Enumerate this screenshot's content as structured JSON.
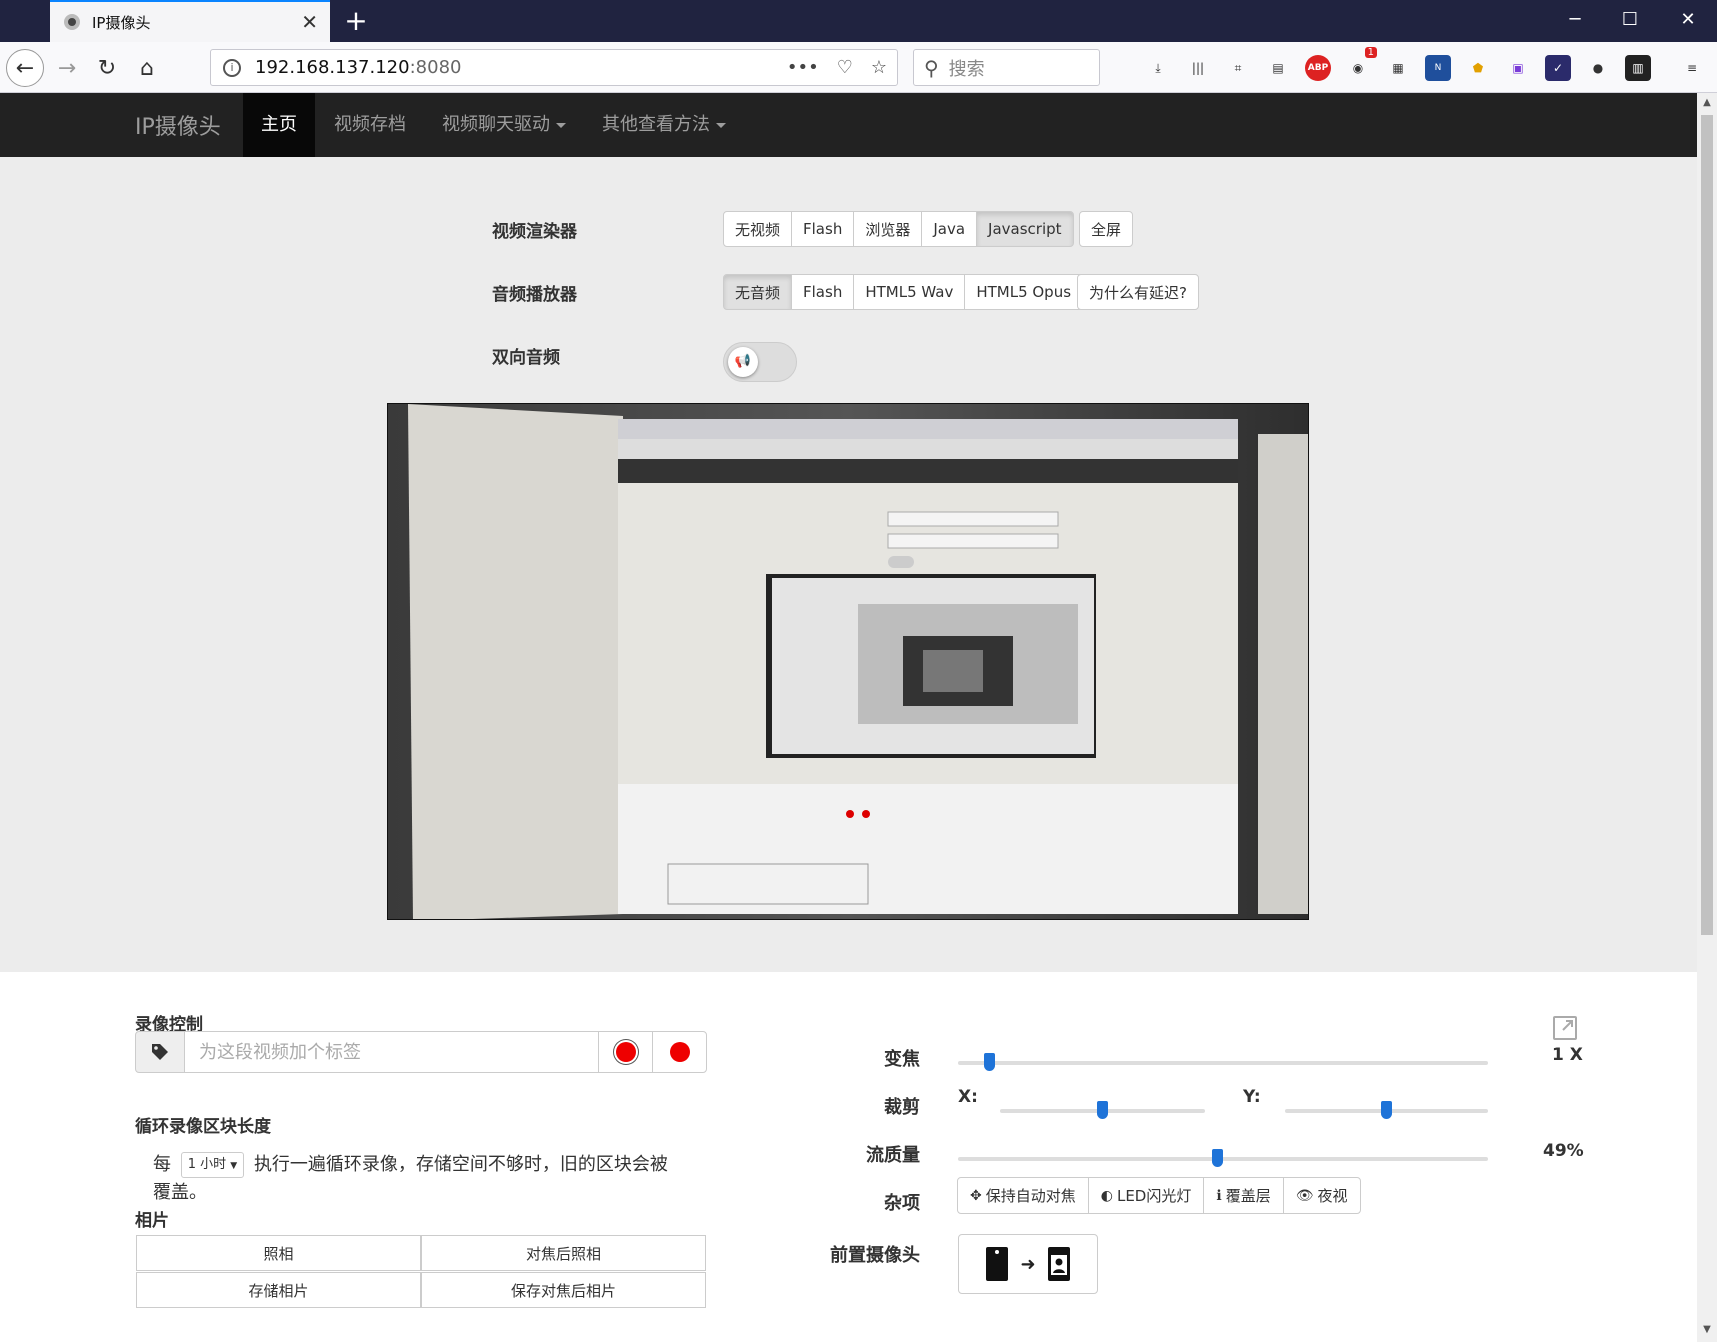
{
  "browser": {
    "tab_title": "IP摄像头",
    "url_host": "192.168.137.120",
    "url_port": ":8080",
    "search_placeholder": "搜索",
    "notification_badge": "1",
    "new_tab_icon": "plus-icon"
  },
  "navbar": {
    "brand": "IP摄像头",
    "items": [
      {
        "label": "主页",
        "active": true
      },
      {
        "label": "视频存档"
      },
      {
        "label": "视频聊天驱动",
        "dropdown": true
      },
      {
        "label": "其他查看方法",
        "dropdown": true
      }
    ]
  },
  "video_renderer": {
    "label": "视频渲染器",
    "options": [
      "无视频",
      "Flash",
      "浏览器",
      "Java",
      "Javascript"
    ],
    "selected": "Javascript",
    "fullscreen": "全屏"
  },
  "audio_player": {
    "label": "音频播放器",
    "options": [
      "无音频",
      "Flash",
      "HTML5 Wav",
      "HTML5 Opus"
    ],
    "selected": "无音频",
    "why_delay": "为什么有延迟?"
  },
  "two_way_audio": {
    "label": "双向音频",
    "enabled": false,
    "icon": "megaphone-icon"
  },
  "recording": {
    "title": "录像控制",
    "tag_placeholder": "为这段视频加个标签",
    "tag_icon": "tag-icon"
  },
  "loop": {
    "title": "循环录像区块长度",
    "prefix": "每",
    "selected": "1 小时",
    "suffix": "执行一遍循环录像，存储空间不够时，旧的区块会被覆盖。"
  },
  "photos": {
    "title": "相片",
    "take": "照相",
    "focus_take": "对焦后照相",
    "store": "存储相片",
    "store_focus": "保存对焦后相片"
  },
  "controls": {
    "zoom_label": "变焦",
    "zoom_value": "1 X",
    "zoom_level": 0.05,
    "crop_label": "裁剪",
    "crop_x": "X:",
    "crop_y": "Y:",
    "crop_x_level": 0.5,
    "crop_y_level": 0.5,
    "quality_label": "流质量",
    "quality_value": "49%",
    "misc_label": "杂项",
    "misc_buttons": [
      {
        "icon": "crosshair-icon",
        "label": "保持自动对焦"
      },
      {
        "icon": "half-circle-icon",
        "label": "LED闪光灯"
      },
      {
        "icon": "info-icon",
        "label": "覆盖层"
      },
      {
        "icon": "eye-icon",
        "label": "夜视"
      }
    ],
    "front_camera_label": "前置摄像头"
  },
  "colors": {
    "navbar_bg": "#222222",
    "slider_handle": "#1e73d8",
    "record_red": "#e00000"
  }
}
